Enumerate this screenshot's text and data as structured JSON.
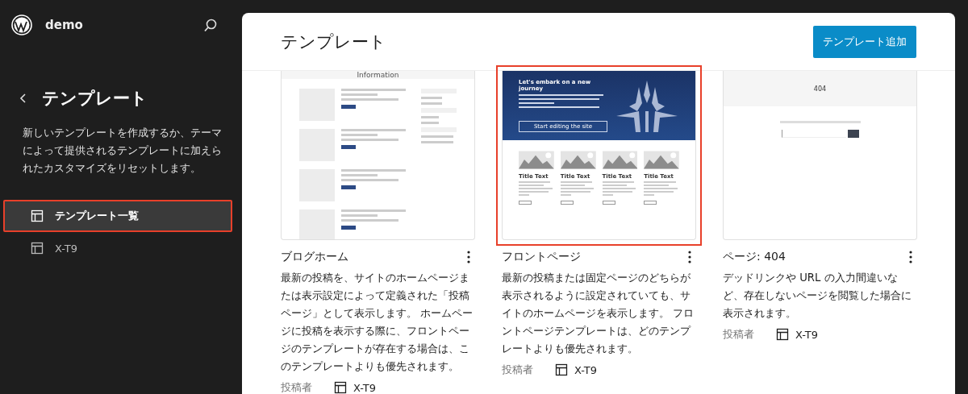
{
  "site": {
    "name": "demo"
  },
  "sidebar": {
    "title": "テンプレート",
    "description": "新しいテンプレートを作成するか、テーマによって提供されるテンプレートに加えられたカスタマイズをリセットします。",
    "items": [
      {
        "label": "テンプレート一覧",
        "selected": true,
        "highlighted": true
      },
      {
        "label": "X-T9",
        "selected": false,
        "highlighted": false
      }
    ]
  },
  "main": {
    "title": "テンプレート",
    "add_button": "テンプレート追加",
    "templates": [
      {
        "title": "ブログホーム",
        "description": "最新の投稿を、サイトのホームページまたは表示設定によって定義された「投稿ページ」として表示します。 ホームページに投稿を表示する際に、フロントページのテンプレートが存在する場合は、このテンプレートよりも優先されます。",
        "author_label": "投稿者",
        "author": "X-T9",
        "highlighted": false,
        "preview": {
          "kind": "blog",
          "heading": "Information"
        }
      },
      {
        "title": "フロントページ",
        "description": "最新の投稿または固定ページのどちらが表示されるように設定されていても、サイトのホームページを表示します。 フロントページテンプレートは、どのテンプレートよりも優先されます。",
        "author_label": "投稿者",
        "author": "X-T9",
        "highlighted": true,
        "preview": {
          "kind": "front",
          "heading": "Let's embark on a new journey",
          "button": "Start editing the site",
          "card_titles": [
            "Title Text",
            "Title Text",
            "Title Text",
            "Title Text"
          ]
        }
      },
      {
        "title": "ページ: 404",
        "description": "デッドリンクや URL の入力間違いなど、存在しないページを閲覧した場合に表示されます。",
        "author_label": "投稿者",
        "author": "X-T9",
        "highlighted": false,
        "preview": {
          "kind": "notfound",
          "heading": "404"
        }
      }
    ]
  }
}
